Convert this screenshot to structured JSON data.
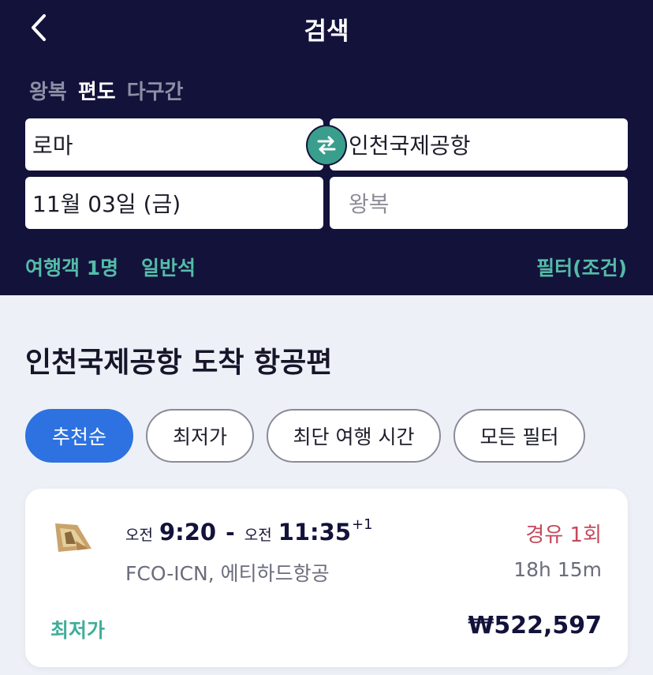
{
  "header": {
    "title": "검색",
    "trip_types": [
      "왕복",
      "편도",
      "다구간"
    ],
    "selected_trip_type": "편도",
    "origin": "로마",
    "destination": "인천국제공항",
    "depart_date": "11월 03일 (금)",
    "return_placeholder": "왕복",
    "passengers": "여행객 1명",
    "cabin": "일반석",
    "filter_link": "필터(조건)"
  },
  "results": {
    "title": "인천국제공항 도착 항공편",
    "sort_chips": [
      "추천순",
      "최저가",
      "최단 여행 시간",
      "모든 필터"
    ],
    "active_chip": "추천순"
  },
  "flight": {
    "depart_ampm": "오전",
    "depart_time": "9:20",
    "dash": "-",
    "arrive_ampm": "오전",
    "arrive_time": "11:35",
    "day_offset": "+1",
    "route": "FCO-ICN, 에티하드항공",
    "stops": "경유 1회",
    "duration": "18h 15m",
    "badge": "최저가",
    "price": "₩522,597"
  },
  "colors": {
    "header_bg": "#13123a",
    "accent_teal": "#54bca8",
    "active_chip": "#2d72e0",
    "stops_red": "#c4495c"
  },
  "icons": {
    "back": "chevron-left-icon",
    "swap": "swap-arrows-icon",
    "airline": "etihad-logo"
  }
}
